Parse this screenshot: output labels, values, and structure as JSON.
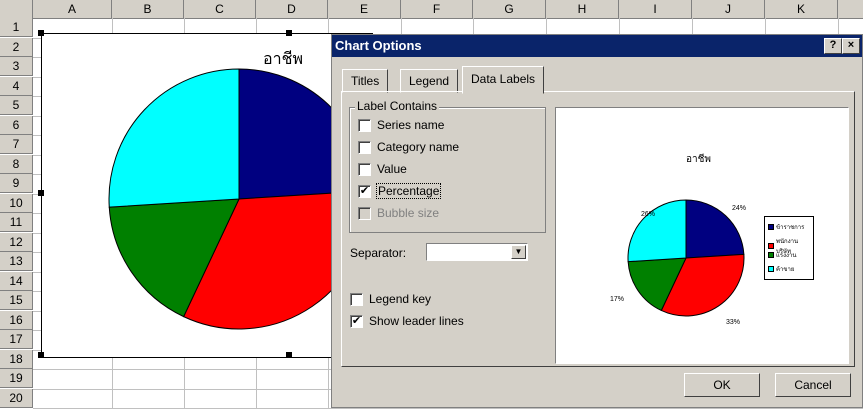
{
  "spreadsheet": {
    "columns": [
      "A",
      "B",
      "C",
      "D",
      "E",
      "F",
      "G",
      "H",
      "I",
      "J",
      "K"
    ],
    "rows": [
      "1",
      "2",
      "3",
      "4",
      "5",
      "6",
      "7",
      "8",
      "9",
      "10",
      "11",
      "12",
      "13",
      "14",
      "15",
      "16",
      "17",
      "18",
      "19",
      "20"
    ]
  },
  "chart": {
    "title": "อาชีพ",
    "chart_data": {
      "type": "pie",
      "title": "อาชีพ",
      "categories": [
        "ข้าราชการ",
        "พนักงานบริษัท",
        "แรงงาน",
        "ค้าขาย"
      ],
      "values": [
        24,
        33,
        17,
        26
      ],
      "colors": [
        "#000080",
        "#ff0000",
        "#008000",
        "#00ffff"
      ]
    }
  },
  "dialog": {
    "title": "Chart Options",
    "help_label": "?",
    "close_label": "×",
    "tabs": [
      {
        "label": "Titles"
      },
      {
        "label": "Legend"
      },
      {
        "label": "Data Labels",
        "active": true
      }
    ],
    "label_contains": {
      "heading": "Label Contains",
      "series_name": {
        "label": "Series name",
        "checked": false
      },
      "category_name": {
        "label": "Category name",
        "checked": false
      },
      "value": {
        "label": "Value",
        "checked": false
      },
      "percentage": {
        "label": "Percentage",
        "checked": true
      },
      "bubble_size": {
        "label": "Bubble size",
        "checked": false,
        "disabled": true
      }
    },
    "separator": {
      "label": "Separator:",
      "value": ""
    },
    "legend_key": {
      "label": "Legend key",
      "checked": false
    },
    "show_leader_lines": {
      "label": "Show leader lines",
      "checked": true
    },
    "preview": {
      "title": "อาชีพ",
      "labels": [
        "24%",
        "33%",
        "17%",
        "26%"
      ],
      "legend": [
        "ข้าราชการ",
        "พนักงานบริษัท",
        "แรงงาน",
        "ค้าขาย"
      ]
    },
    "ok_label": "OK",
    "cancel_label": "Cancel"
  }
}
